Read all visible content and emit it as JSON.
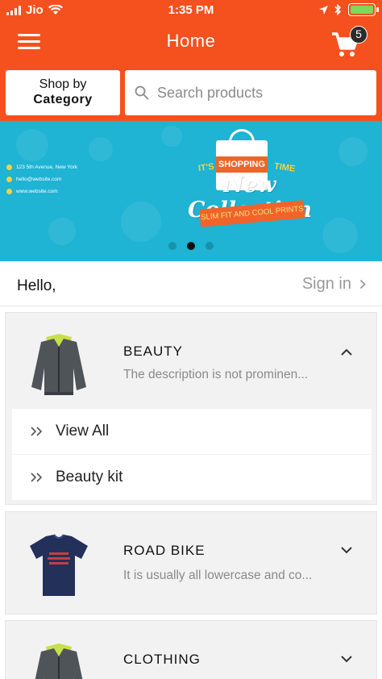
{
  "status_bar": {
    "carrier": "Jio",
    "time": "1:35 PM",
    "battery_color": "#7ed957"
  },
  "app_bar": {
    "title": "Home",
    "menu_icon": "hamburger-menu-icon",
    "cart_icon": "shopping-cart-icon",
    "cart_count": "5",
    "background_color": "#f4511e"
  },
  "search_row": {
    "shop_by_line1": "Shop by",
    "shop_by_line2": "Category",
    "search_placeholder": "Search products"
  },
  "banner": {
    "contact_address": "123 5th Avenue, New York",
    "contact_email": "hello@website.com",
    "contact_web": "www.website.com",
    "its": "IT'S",
    "shopping": "SHOPPING",
    "time": "TIME",
    "headline": "New Collection",
    "ribbon": "SLIM FIT AND COOL PRINTS",
    "slide_count": 3,
    "active_slide": 2,
    "background_color": "#1fb3d4"
  },
  "greeting": {
    "hello": "Hello,",
    "sign_in": "Sign in"
  },
  "categories": [
    {
      "title": "BEAUTY",
      "description": "The description is not prominen...",
      "expanded": true,
      "image": "grey-jacket-image",
      "subitems": [
        {
          "label": "View All"
        },
        {
          "label": "Beauty kit"
        }
      ]
    },
    {
      "title": "ROAD BIKE",
      "description": "It is usually all lowercase and co...",
      "expanded": false,
      "image": "navy-tshirt-image"
    },
    {
      "title": "CLOTHING",
      "description": "",
      "expanded": false,
      "image": "grey-jacket-image"
    }
  ]
}
